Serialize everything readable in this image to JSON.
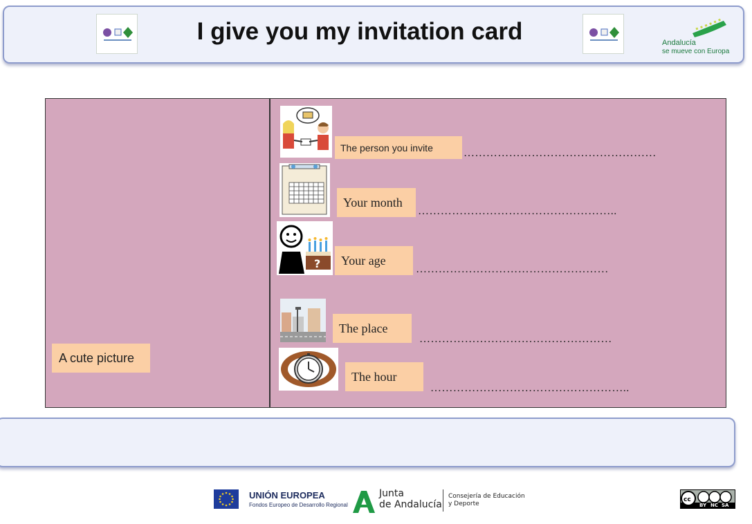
{
  "header": {
    "title": "I give you my invitation card",
    "andalucia_line1": "Andalucía",
    "andalucia_line2": "se mueve con Europa"
  },
  "card": {
    "left_label": "A cute picture",
    "rows": [
      {
        "label": "The person you invite",
        "icon": "two-people-exchanging-card-icon",
        "dots": "……………………………………………"
      },
      {
        "label": "Your month",
        "icon": "calendar-icon",
        "dots": "…………………………………………….."
      },
      {
        "label": "Your age",
        "icon": "birthday-cake-person-icon",
        "dots": "……………………………………………"
      },
      {
        "label": "The place",
        "icon": "street-town-icon",
        "dots": "……………………………………………"
      },
      {
        "label": "The hour",
        "icon": "wristwatch-icon",
        "dots": "…………………………………………….."
      }
    ]
  },
  "footer": {
    "eu_title": "UNIÓN EUROPEA",
    "eu_subtitle": "Fondos Europeo de Desarrollo Regional",
    "junta_line1": "Junta",
    "junta_line2": "de Andalucía",
    "consejeria_line1": "Consejería de Educación",
    "consejeria_line2": "y Deporte",
    "cc_labels": [
      "BY",
      "NC",
      "SA"
    ]
  }
}
